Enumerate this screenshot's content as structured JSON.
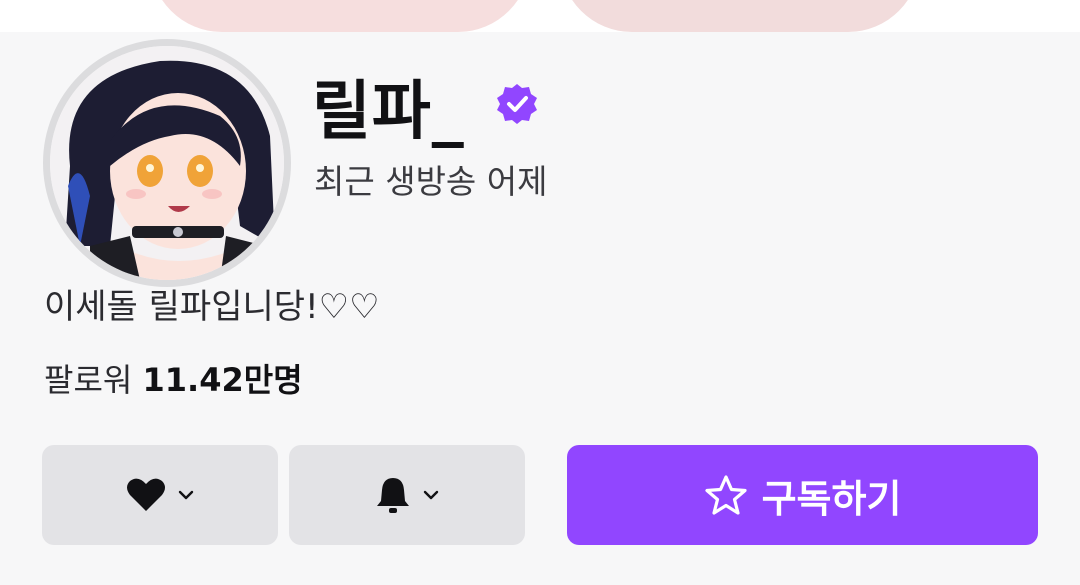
{
  "banner": {
    "image": "channel-banner-art"
  },
  "channel": {
    "name": "릴파_",
    "verified": true,
    "last_live": "최근 생방송 어제",
    "bio": "이세돌 릴파입니당!♡♡",
    "followers_label": "팔로워",
    "followers_count": "11.42만명"
  },
  "actions": {
    "like_icon": "heart-icon",
    "notify_icon": "bell-icon",
    "subscribe_icon": "star-icon",
    "subscribe_label": "구독하기"
  },
  "colors": {
    "accent": "#9146ff",
    "button_gray": "#e3e3e6",
    "background": "#f7f7f8"
  }
}
